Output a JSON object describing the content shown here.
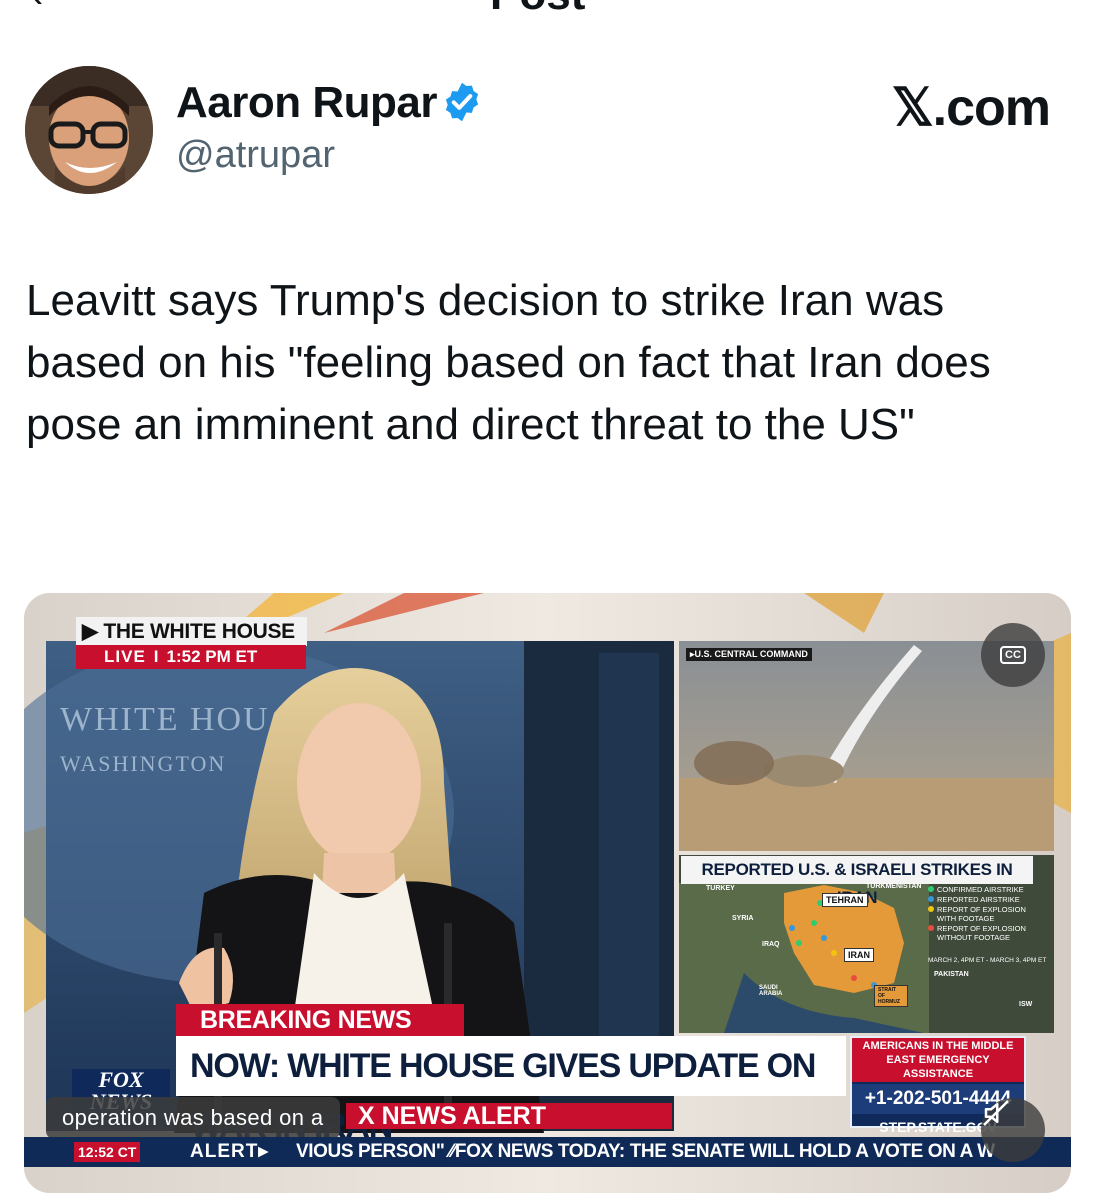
{
  "topbar": {
    "title": "Post"
  },
  "author": {
    "name": "Aaron Rupar",
    "handle": "@atrupar",
    "verified": true
  },
  "brand": {
    "label": "𝕏.com"
  },
  "post": {
    "text": "Leavitt says Trump's decision to strike Iran was based on his \"feeling based on fact that Iran does pose an imminent and direct threat to the US\""
  },
  "video": {
    "location_label": "▶ THE WHITE HOUSE",
    "live_label": "LIVE",
    "live_separator": "I",
    "live_time": "1:52 PM ET",
    "sign_line1": "WHITE HOU",
    "sign_line2": "WASHINGTON",
    "inset_source": "▸U.S. CENTRAL COMMAND",
    "map_title": "REPORTED U.S. & ISRAELI STRIKES IN IRAN",
    "map_labels": {
      "tehran": "TEHRAN",
      "iran": "IRAN",
      "turkey": "TURKEY",
      "syria": "SYRIA",
      "iraq": "IRAQ",
      "saudi": "SAUDI ARABIA",
      "turkmenistan": "TURKMENISTAN",
      "pakistan": "PAKISTAN",
      "hormuz": "STRAIT OF HORMUZ",
      "isw": "ISW"
    },
    "legend": [
      {
        "label": "CONFIRMED AIRSTRIKE",
        "color": "#2ecc71"
      },
      {
        "label": "REPORTED AIRSTRIKE",
        "color": "#3498db"
      },
      {
        "label": "REPORT OF EXPLOSION WITH FOOTAGE",
        "color": "#f1c40f"
      },
      {
        "label": "REPORT OF EXPLOSION WITHOUT FOOTAGE",
        "color": "#e74c3c"
      }
    ],
    "legend_dates": "MARCH 2, 4PM ET - MARCH 3, 4PM ET",
    "breaking_label": "BREAKING NEWS",
    "headline": "NOW: WHITE HOUSE GIVES UPDATE ON WAR IN IRAN",
    "emergency": {
      "title": "AMERICANS IN THE MIDDLE EAST EMERGENCY ASSISTANCE",
      "phone": "+1-202-501-4444",
      "url": "STEP.STATE.GOV"
    },
    "network_logo": "FOX NEWS",
    "alert_banner": "X NEWS ALERT",
    "caption": "operation was based on a",
    "ticker_time": "12:52 CT",
    "ticker_alert": "ALERT▸",
    "ticker_text": "VIOUS PERSON\"  ⁄⁄FOX NEWS  TODAY: THE SENATE WILL HOLD A VOTE ON A W",
    "cc_label": "CC"
  },
  "colors": {
    "text": "#0f1419",
    "secondary": "#536471",
    "verified": "#1d9bf0",
    "fox_red": "#c8102e",
    "fox_navy": "#102a58"
  }
}
